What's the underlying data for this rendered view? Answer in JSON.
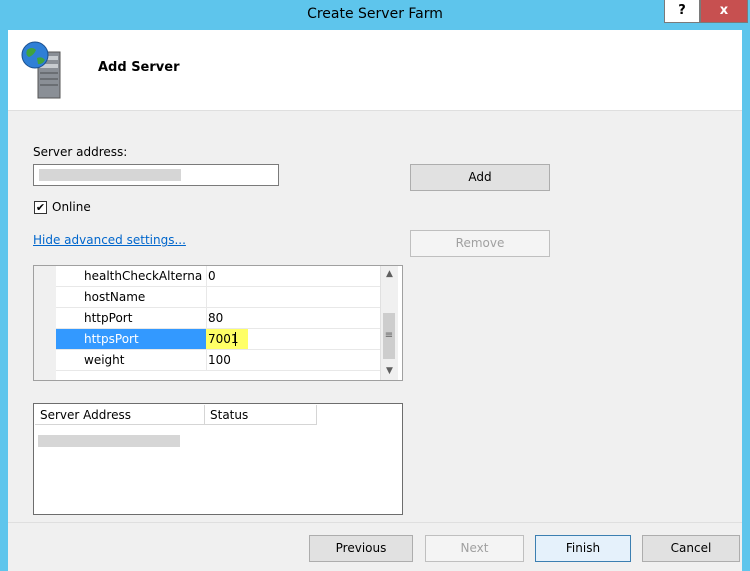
{
  "window": {
    "title": "Create Server Farm",
    "help_label": "?",
    "close_label": "x"
  },
  "header": {
    "title": "Add Server"
  },
  "form": {
    "server_address_label": "Server address:",
    "server_address_value": "",
    "online_label": "Online",
    "online_checked": true,
    "advanced_link": "Hide advanced settings...",
    "add_button": "Add",
    "remove_button": "Remove"
  },
  "properties": [
    {
      "name": "healthCheckAlternat",
      "value": "0"
    },
    {
      "name": "hostName",
      "value": ""
    },
    {
      "name": "httpPort",
      "value": "80"
    },
    {
      "name": "httpsPort",
      "value": "7001"
    },
    {
      "name": "weight",
      "value": "100"
    }
  ],
  "server_list": {
    "columns": [
      "Server Address",
      "Status"
    ]
  },
  "footer": {
    "previous": "Previous",
    "next": "Next",
    "finish": "Finish",
    "cancel": "Cancel"
  },
  "colors": {
    "titlebar": "#5ec5ec",
    "selection": "#3399ff",
    "highlight": "#ffff66",
    "close": "#c75050"
  }
}
